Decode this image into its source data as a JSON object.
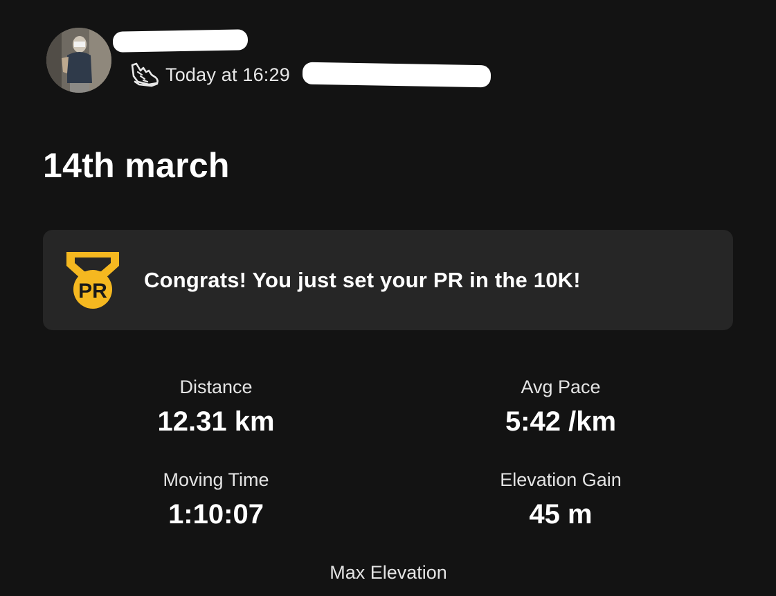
{
  "header": {
    "timestamp": "Today at 16:29",
    "activity_icon": "running-shoe-icon"
  },
  "activity": {
    "title": "14th march"
  },
  "pr_banner": {
    "badge_text": "PR",
    "badge_icon": "pr-medal-icon",
    "message": "Congrats! You just set your PR in the 10K!",
    "accent_color": "#F5B820"
  },
  "stats": {
    "distance": {
      "label": "Distance",
      "value": "12.31 km"
    },
    "avg_pace": {
      "label": "Avg Pace",
      "value": "5:42 /km"
    },
    "moving_time": {
      "label": "Moving Time",
      "value": "1:10:07"
    },
    "elevation_gain": {
      "label": "Elevation Gain",
      "value": "45 m"
    },
    "max_elevation": {
      "label": "Max Elevation"
    }
  },
  "colors": {
    "background": "#131313",
    "card": "#262626",
    "text": "#FFFFFF"
  }
}
